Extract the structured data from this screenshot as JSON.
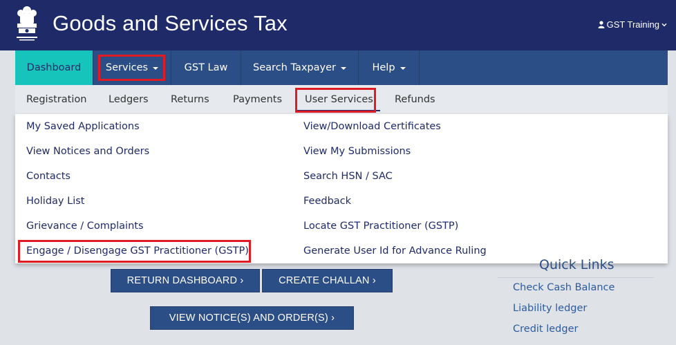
{
  "header": {
    "title": "Goods and Services Tax",
    "user_name": "GST Training"
  },
  "nav": {
    "items": [
      {
        "label": "Dashboard"
      },
      {
        "label": "Services"
      },
      {
        "label": "GST Law"
      },
      {
        "label": "Search Taxpayer"
      },
      {
        "label": "Help"
      }
    ]
  },
  "sub_nav": {
    "items": [
      {
        "label": "Registration"
      },
      {
        "label": "Ledgers"
      },
      {
        "label": "Returns"
      },
      {
        "label": "Payments"
      },
      {
        "label": "User Services"
      },
      {
        "label": "Refunds"
      }
    ]
  },
  "dropdown": {
    "left": [
      "My Saved Applications",
      "View Notices and Orders",
      "Contacts",
      "Holiday List",
      "Grievance / Complaints",
      "Engage / Disengage GST Practitioner (GSTP)"
    ],
    "right": [
      "View/Download Certificates",
      "View My Submissions",
      "Search HSN / SAC",
      "Feedback",
      "Locate GST Practitioner (GSTP)",
      "Generate User Id for Advance Ruling"
    ]
  },
  "buttons": {
    "return_dashboard": "RETURN DASHBOARD ›",
    "create_challan": "CREATE CHALLAN ›",
    "view_notices": "VIEW NOTICE(S) AND ORDER(S) ›"
  },
  "quick_links": {
    "title": "Quick Links",
    "items": [
      "Check Cash Balance",
      "Liability ledger",
      "Credit ledger"
    ]
  },
  "colors": {
    "header_bg": "#1f2b69",
    "nav_bg": "#2c4e86",
    "active_tab": "#17c4bb",
    "highlight": "#e01b24",
    "link": "#2c5aa0"
  }
}
